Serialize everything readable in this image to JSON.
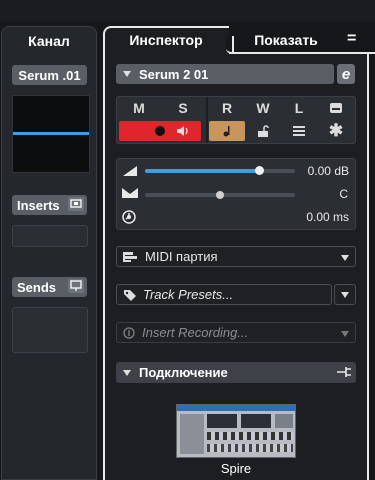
{
  "channel": {
    "tab_label": "Канал",
    "name": "Serum .01",
    "inserts_label": "Inserts",
    "sends_label": "Sends"
  },
  "inspector": {
    "tab_label": "Инспектор",
    "show_label": "Показать",
    "menu_glyph": "=",
    "track_name": "Serum 2 01",
    "edit_glyph": "e",
    "buttons": {
      "m": "M",
      "s": "S",
      "r": "R",
      "w": "W",
      "l": "L"
    },
    "volume": {
      "value_text": "0.00 dB",
      "level": 0.76
    },
    "pan": {
      "value_text": "C",
      "level": 0.5
    },
    "delay": {
      "value_text": "0.00 ms"
    },
    "midi_part_label": "MIDI партия",
    "track_presets_label": "Track Presets...",
    "insert_recording_label": "Insert Recording...",
    "connection_label": "Подключение",
    "plugin_label": "Spire"
  },
  "colors": {
    "record": "#e0262d",
    "monitor": "#c8955a",
    "meter": "#3d9ee8",
    "accent_border": "#e8e8e8"
  }
}
